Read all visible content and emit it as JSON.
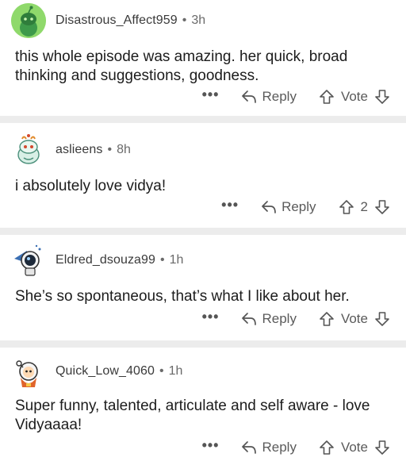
{
  "comments": [
    {
      "username": "Disastrous_Affect959",
      "separator": "•",
      "time": "3h",
      "text": "this whole episode was amazing. her quick, broad thinking and suggestions, goodness.",
      "more": "•••",
      "reply": "Reply",
      "vote": "Vote",
      "avatar_color": "#8fd96b"
    },
    {
      "username": "aslieens",
      "separator": "•",
      "time": "8h",
      "text": "i absolutely love vidya!",
      "more": "•••",
      "reply": "Reply",
      "vote": "2",
      "avatar_color": "#ffffff"
    },
    {
      "username": "Eldred_dsouza99",
      "separator": "•",
      "time": "1h",
      "text": "She’s so spontaneous, that’s what I like about her.",
      "more": "•••",
      "reply": "Reply",
      "vote": "Vote",
      "avatar_color": "#ffffff"
    },
    {
      "username": "Quick_Low_4060",
      "separator": "•",
      "time": "1h",
      "text": "Super funny, talented, articulate and self aware - love Vidyaaaa!",
      "more": "•••",
      "reply": "Reply",
      "vote": "Vote",
      "avatar_color": "#ffffff"
    }
  ]
}
